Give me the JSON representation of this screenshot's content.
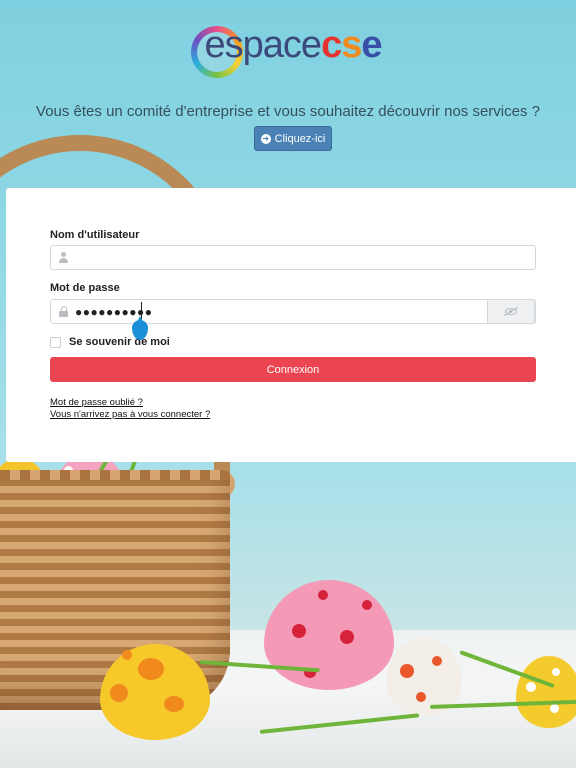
{
  "brand": {
    "logo_part1": "espace",
    "logo_c": "c",
    "logo_s": "s",
    "logo_e": "e"
  },
  "intro": {
    "tagline": "Vous êtes un comité d'entreprise et vous souhaitez découvrir nos services ?",
    "cta_label": "Cliquez-ici"
  },
  "login": {
    "username_label": "Nom d'utilisateur",
    "username_value": "",
    "password_label": "Mot de passe",
    "password_value": "●●●●●●●●●●",
    "remember_label": "Se souvenir de moi",
    "remember_checked": false,
    "submit_label": "Connexion",
    "forgot_link": "Mot de passe oublié ?",
    "help_link": "Vous n'arrivez pas à vous connecter ?"
  },
  "colors": {
    "accent_red": "#ea4551",
    "button_blue": "#4a82b5",
    "sky": "#8fd6e4"
  },
  "icons": [
    "logo-ring-icon",
    "arrow-circle-right-icon",
    "user-icon",
    "lock-icon",
    "eye-slash-icon",
    "text-cursor-drop-icon"
  ]
}
